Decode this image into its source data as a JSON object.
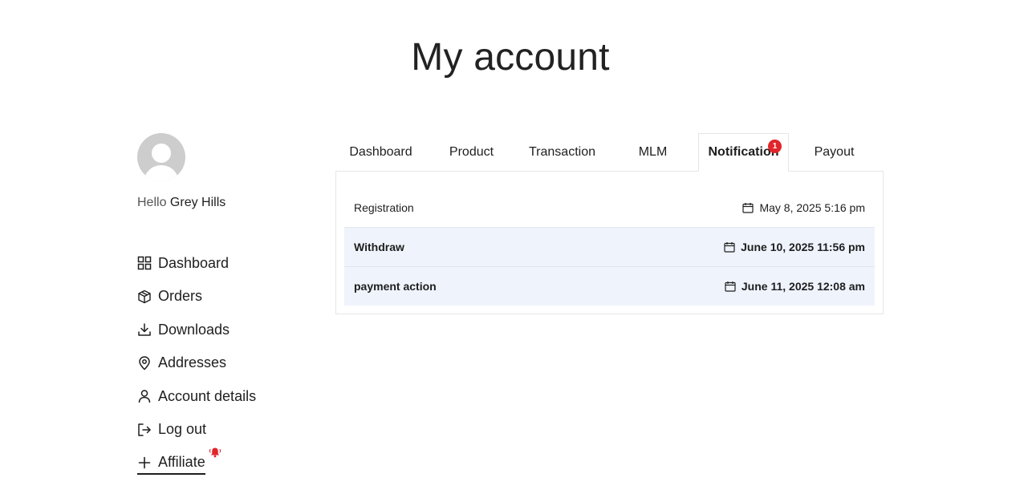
{
  "page": {
    "title": "My account"
  },
  "user": {
    "greeting": "Hello",
    "name": "Grey Hills"
  },
  "nav": {
    "items": [
      {
        "label": "Dashboard",
        "icon": "grid-icon"
      },
      {
        "label": "Orders",
        "icon": "package-icon"
      },
      {
        "label": "Downloads",
        "icon": "download-icon"
      },
      {
        "label": "Addresses",
        "icon": "map-pin-icon"
      },
      {
        "label": "Account details",
        "icon": "user-icon"
      },
      {
        "label": "Log out",
        "icon": "logout-icon"
      },
      {
        "label": "Affiliate",
        "icon": "plus-icon",
        "active": true,
        "alert_icon": "bell-ringing-icon"
      }
    ]
  },
  "tabs": [
    {
      "label": "Dashboard"
    },
    {
      "label": "Product"
    },
    {
      "label": "Transaction"
    },
    {
      "label": "MLM"
    },
    {
      "label": "Notification",
      "active": true,
      "badge": "1"
    },
    {
      "label": "Payout"
    }
  ],
  "notifications": [
    {
      "title": "Registration",
      "date": "May 8, 2025 5:16 pm",
      "unread": false
    },
    {
      "title": "Withdraw",
      "date": "June 10, 2025 11:56 pm",
      "unread": true
    },
    {
      "title": "payment action",
      "date": "June 11, 2025 12:08 am",
      "unread": true
    }
  ],
  "colors": {
    "badge": "#e0252b",
    "unread_row": "#eff3fc",
    "avatar": "#cdcdcd"
  }
}
